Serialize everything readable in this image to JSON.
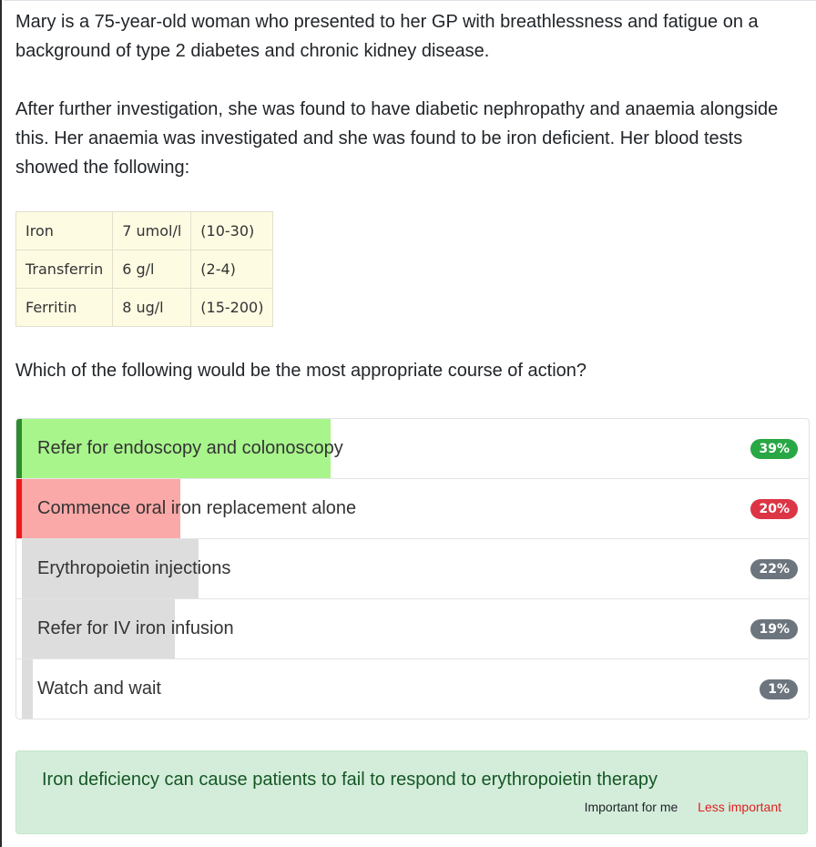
{
  "stem": {
    "paragraph1": "Mary is a 75-year-old woman who presented to her GP with breathlessness and fatigue on a background of type 2 diabetes and chronic kidney disease.",
    "paragraph2": "After further investigation, she was found to have diabetic nephropathy and anaemia alongside this. Her anaemia was investigated and she was found to be iron deficient. Her blood tests showed the following:"
  },
  "labs": [
    {
      "name": "Iron",
      "value": "7 umol/l",
      "range": "(10-30)"
    },
    {
      "name": "Transferrin",
      "value": "6 g/l",
      "range": "(2-4)"
    },
    {
      "name": "Ferritin",
      "value": "8 ug/l",
      "range": "(15-200)"
    }
  ],
  "question": "Which of the following would be the most appropriate course of action?",
  "answers": [
    {
      "label": "Refer for endoscopy and colonoscopy",
      "percent": 39,
      "percent_label": "39%",
      "state": "correct"
    },
    {
      "label": "Commence oral iron replacement alone",
      "percent": 20,
      "percent_label": "20%",
      "state": "selected-wrong"
    },
    {
      "label": "Erythropoietin injections",
      "percent": 22,
      "percent_label": "22%",
      "state": "neutral"
    },
    {
      "label": "Refer for IV iron infusion",
      "percent": 19,
      "percent_label": "19%",
      "state": "neutral"
    },
    {
      "label": "Watch and wait",
      "percent": 1,
      "percent_label": "1%",
      "state": "neutral"
    }
  ],
  "colors": {
    "correct_bar": "#a8f58c",
    "correct_edge": "#2e8b2e",
    "correct_badge": "#28a745",
    "wrong_bar": "#fba8a8",
    "wrong_edge": "#f01818",
    "wrong_badge": "#dc3545",
    "neutral_bar": "#dddddd",
    "neutral_edge": "#dddddd",
    "neutral_badge": "#6c757d"
  },
  "feedback": {
    "message": "Iron deficiency can cause patients to fail to respond to erythropoietin therapy",
    "important_label": "Important for me",
    "less_important_label": "Less important"
  }
}
